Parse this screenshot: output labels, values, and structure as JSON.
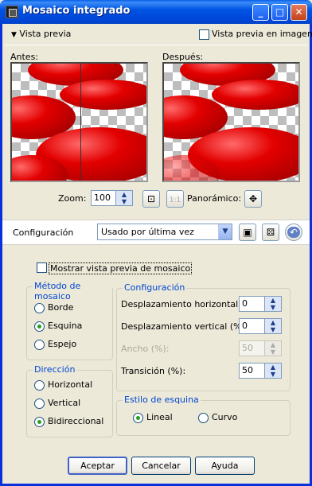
{
  "window": {
    "title": "Mosaico integrado"
  },
  "title_buttons": {
    "minimize": "_",
    "maximize": "□",
    "close": "✕"
  },
  "preview_toggle": {
    "label": "Vista previa",
    "preview_in_image_label": "Vista previa en imagen"
  },
  "before_label": "Antes:",
  "after_label": "Después:",
  "zoom": {
    "label": "Zoom:",
    "value": "100",
    "panoramic_label": "Panorámico:"
  },
  "config_bar": {
    "label": "Configuración",
    "preset_value": "Usado por última vez"
  },
  "show_tile_preview": {
    "label": "Mostrar vista previa de mosaico",
    "checked": false
  },
  "tile_method": {
    "title": "Método de mosaico",
    "options": [
      {
        "label": "Borde",
        "selected": false
      },
      {
        "label": "Esquina",
        "selected": true
      },
      {
        "label": "Espejo",
        "selected": false
      }
    ]
  },
  "direction": {
    "title": "Dirección",
    "options": [
      {
        "label": "Horizontal",
        "selected": false
      },
      {
        "label": "Vertical",
        "selected": false
      },
      {
        "label": "Bidireccional",
        "selected": true
      }
    ]
  },
  "settings": {
    "title": "Configuración",
    "fields": [
      {
        "label": "Desplazamiento horizontal (%):",
        "value": "0",
        "enabled": true
      },
      {
        "label": "Desplazamiento vertical (%):",
        "value": "0",
        "enabled": true
      },
      {
        "label": "Ancho (%):",
        "value": "50",
        "enabled": false
      },
      {
        "label": "Transición (%):",
        "value": "50",
        "enabled": true
      }
    ]
  },
  "corner_style": {
    "title": "Estilo de esquina",
    "options": [
      {
        "label": "Lineal",
        "selected": true
      },
      {
        "label": "Curvo",
        "selected": false
      }
    ]
  },
  "buttons": {
    "accept": "Aceptar",
    "cancel": "Cancelar",
    "help": "Ayuda"
  }
}
